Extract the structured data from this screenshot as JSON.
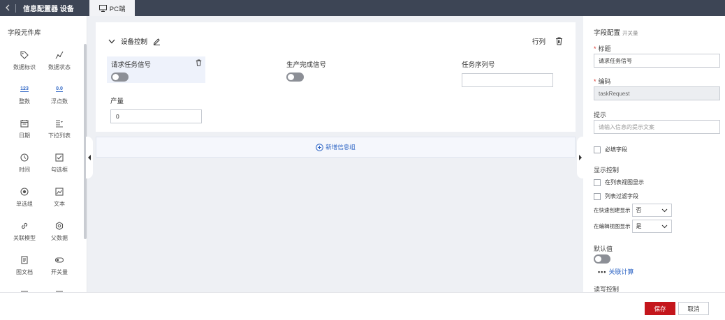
{
  "header": {
    "back_icon": "chevron-left-icon",
    "title": "信息配置器 设备",
    "tab_label": "PC端",
    "tab_icon": "monitor-icon"
  },
  "library": {
    "title": "字段元件库",
    "items": [
      {
        "label": "数据标识",
        "icon": "tag-icon"
      },
      {
        "label": "数据状态",
        "icon": "trend-icon"
      },
      {
        "label": "整数",
        "icon": "integer-icon",
        "glyph": "123"
      },
      {
        "label": "浮点数",
        "icon": "float-icon",
        "glyph": "0.0"
      },
      {
        "label": "日期",
        "icon": "calendar-icon"
      },
      {
        "label": "下拉列表",
        "icon": "dropdown-list-icon"
      },
      {
        "label": "时间",
        "icon": "clock-icon"
      },
      {
        "label": "勾选框",
        "icon": "checkbox-icon"
      },
      {
        "label": "单选组",
        "icon": "radio-icon"
      },
      {
        "label": "文本",
        "icon": "text-icon"
      },
      {
        "label": "关联模型",
        "icon": "link-icon"
      },
      {
        "label": "父数据",
        "icon": "gear-icon"
      },
      {
        "label": "图文档",
        "icon": "document-icon"
      },
      {
        "label": "开关量",
        "icon": "switch-icon"
      }
    ]
  },
  "canvas": {
    "group_title": "设备控制",
    "row_col_label": "行列",
    "fields": {
      "request": {
        "label": "请求任务信号"
      },
      "complete": {
        "label": "生产完成信号"
      },
      "serial": {
        "label": "任务序列号",
        "value": ""
      },
      "output": {
        "label": "产量",
        "value": "0"
      }
    },
    "add_group_label": "新增信息组"
  },
  "config": {
    "title": "字段配置",
    "subtitle": "开关量",
    "title_label": "标题",
    "title_value": "请求任务信号",
    "code_label": "编码",
    "code_value": "taskRequest",
    "hint_label": "提示",
    "hint_placeholder": "请输入信息的提示文案",
    "required_label": "必填字段",
    "display_control": "显示控制",
    "show_in_list": "在列表视图显示",
    "list_filter": "列表过滤字段",
    "quick_create_label": "在快速创建显示",
    "quick_create_value": "否",
    "edit_view_label": "在编辑视图显示",
    "edit_view_value": "是",
    "default_label": "默认值",
    "related_calc": "关联计算",
    "rw_control": "读写控制"
  },
  "footer": {
    "save": "保存",
    "cancel": "取消"
  },
  "colors": {
    "topbar": "#3d4555",
    "primary_red": "#c4161c",
    "link_blue": "#2f66c5",
    "canvas_bg": "#eef0f4"
  }
}
